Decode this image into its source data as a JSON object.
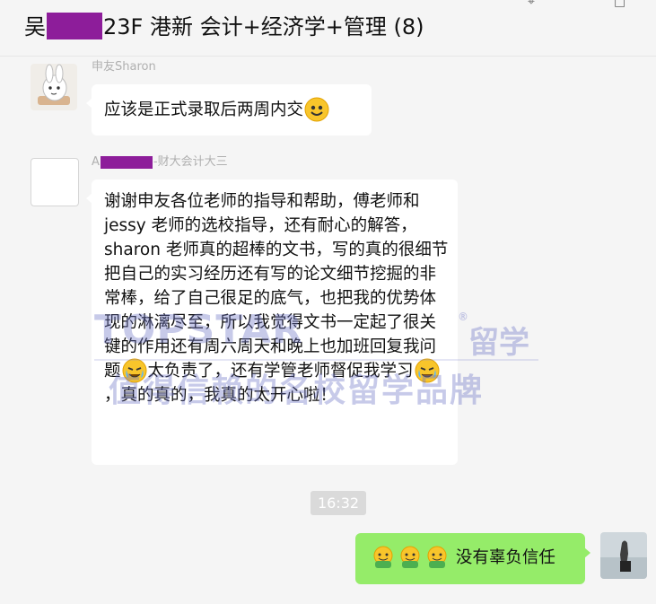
{
  "header": {
    "title_prefix": "吴",
    "title_suffix": "23F 港新 会计+经济学+管理",
    "member_count": "(8)",
    "window_pin_icon": "pin-icon",
    "window_restore_icon": "restore-icon"
  },
  "messages": [
    {
      "sender": "申友Sharon",
      "text": "应该是正式录取后两周内交",
      "emoji": "grinning-face-emoji"
    },
    {
      "sender_prefix": "A",
      "sender_suffix": "-财大会计大三",
      "text_before_emoji_1": "谢谢申友各位老师的指导和帮助，傅老师和jessy 老师的选校指导，还有耐心的解答，sharon 老师真的超棒的文书，写的真的很细节把自己的实习经历还有写的论文细节挖掘的非常棒，给了自己很足的底气，也把我的优势体现的淋漓尽至，所以我觉得文书一定起了很关键的作用还有周六周天和晚上也加班回复我问题",
      "text_between_emojis": "太负责了，还有学管老师督促我学习",
      "text_after_emoji_2": "，真的真的，我真的太开心啦！",
      "emoji": "tears-of-joy-emoji"
    }
  ],
  "timestamp": "16:32",
  "reply": {
    "text": "没有辜负信任",
    "emoji": "hugging-face-emoji",
    "emoji_count": 3
  },
  "watermark": {
    "line_1": "TOPSTAR",
    "line_1_suffix": "留学",
    "line_2": "值得信赖的名校留学品牌",
    "registered_mark": "®"
  },
  "colors": {
    "background": "#f5f5f5",
    "bubble_white": "#ffffff",
    "bubble_green": "#95ec69",
    "redaction": "#8d1d9a",
    "watermark": "#6f75c7"
  }
}
